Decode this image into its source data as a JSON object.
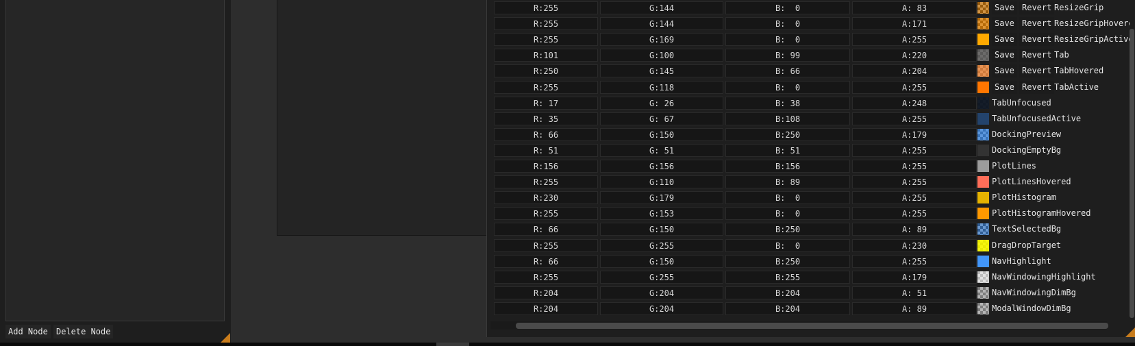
{
  "left_panel": {
    "add_node_label": "Add Node",
    "delete_node_label": "Delete Node"
  },
  "style_editor": {
    "save_label": "Save",
    "revert_label": "Revert",
    "rows": [
      {
        "name": "ResizeGrip",
        "r": "R:255",
        "g": "G:144",
        "b": "B:  0",
        "a": "A: 83",
        "color": "#ff9000",
        "alpha": 83,
        "editable": true
      },
      {
        "name": "ResizeGripHovered",
        "r": "R:255",
        "g": "G:144",
        "b": "B:  0",
        "a": "A:171",
        "color": "#ff9000",
        "alpha": 171,
        "editable": true
      },
      {
        "name": "ResizeGripActive",
        "r": "R:255",
        "g": "G:169",
        "b": "B:  0",
        "a": "A:255",
        "color": "#ffa900",
        "alpha": 255,
        "editable": true
      },
      {
        "name": "Tab",
        "r": "R:101",
        "g": "G:100",
        "b": "B: 99",
        "a": "A:220",
        "color": "#656463",
        "alpha": 220,
        "editable": true
      },
      {
        "name": "TabHovered",
        "r": "R:250",
        "g": "G:145",
        "b": "B: 66",
        "a": "A:204",
        "color": "#fa9142",
        "alpha": 204,
        "editable": true
      },
      {
        "name": "TabActive",
        "r": "R:255",
        "g": "G:118",
        "b": "B:  0",
        "a": "A:255",
        "color": "#ff7600",
        "alpha": 255,
        "editable": true
      },
      {
        "name": "TabUnfocused",
        "r": "R: 17",
        "g": "G: 26",
        "b": "B: 38",
        "a": "A:248",
        "color": "#111a26",
        "alpha": 248,
        "editable": false
      },
      {
        "name": "TabUnfocusedActive",
        "r": "R: 35",
        "g": "G: 67",
        "b": "B:108",
        "a": "A:255",
        "color": "#23436c",
        "alpha": 255,
        "editable": false
      },
      {
        "name": "DockingPreview",
        "r": "R: 66",
        "g": "G:150",
        "b": "B:250",
        "a": "A:179",
        "color": "#4296fa",
        "alpha": 179,
        "editable": false
      },
      {
        "name": "DockingEmptyBg",
        "r": "R: 51",
        "g": "G: 51",
        "b": "B: 51",
        "a": "A:255",
        "color": "#333333",
        "alpha": 255,
        "editable": false
      },
      {
        "name": "PlotLines",
        "r": "R:156",
        "g": "G:156",
        "b": "B:156",
        "a": "A:255",
        "color": "#9c9c9c",
        "alpha": 255,
        "editable": false
      },
      {
        "name": "PlotLinesHovered",
        "r": "R:255",
        "g": "G:110",
        "b": "B: 89",
        "a": "A:255",
        "color": "#ff6e59",
        "alpha": 255,
        "editable": false
      },
      {
        "name": "PlotHistogram",
        "r": "R:230",
        "g": "G:179",
        "b": "B:  0",
        "a": "A:255",
        "color": "#e6b300",
        "alpha": 255,
        "editable": false
      },
      {
        "name": "PlotHistogramHovered",
        "r": "R:255",
        "g": "G:153",
        "b": "B:  0",
        "a": "A:255",
        "color": "#ff9900",
        "alpha": 255,
        "editable": false
      },
      {
        "name": "TextSelectedBg",
        "r": "R: 66",
        "g": "G:150",
        "b": "B:250",
        "a": "A: 89",
        "color": "#4296fa",
        "alpha": 89,
        "editable": false
      },
      {
        "name": "DragDropTarget",
        "r": "R:255",
        "g": "G:255",
        "b": "B:  0",
        "a": "A:230",
        "color": "#ffff00",
        "alpha": 230,
        "editable": false
      },
      {
        "name": "NavHighlight",
        "r": "R: 66",
        "g": "G:150",
        "b": "B:250",
        "a": "A:255",
        "color": "#4296fa",
        "alpha": 255,
        "editable": false
      },
      {
        "name": "NavWindowingHighlight",
        "r": "R:255",
        "g": "G:255",
        "b": "B:255",
        "a": "A:179",
        "color": "#ffffff",
        "alpha": 179,
        "editable": false
      },
      {
        "name": "NavWindowingDimBg",
        "r": "R:204",
        "g": "G:204",
        "b": "B:204",
        "a": "A: 51",
        "color": "#cccccc",
        "alpha": 51,
        "editable": false
      },
      {
        "name": "ModalWindowDimBg",
        "r": "R:204",
        "g": "G:204",
        "b": "B:204",
        "a": "A: 89",
        "color": "#cccccc",
        "alpha": 89,
        "editable": false
      }
    ]
  },
  "colors": {
    "accent_orange": "#c87c1c",
    "panel_bg": "#1e1e1e",
    "app_bg": "#2d2d2d"
  }
}
